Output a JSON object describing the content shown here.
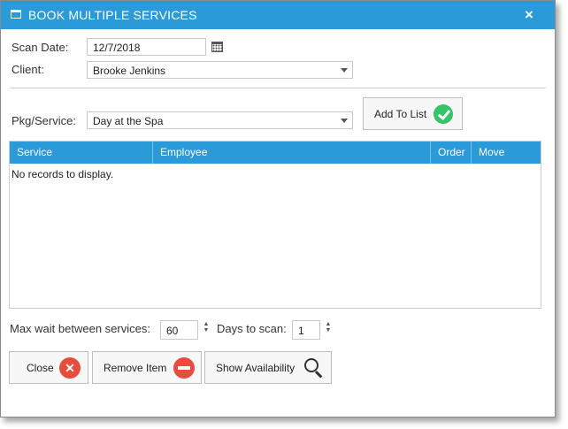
{
  "dialog": {
    "title": "BOOK MULTIPLE SERVICES",
    "close_glyph": "×"
  },
  "scan_date": {
    "label": "Scan Date:",
    "value": "12/7/2018"
  },
  "client": {
    "label": "Client:",
    "value": "Brooke Jenkins"
  },
  "service": {
    "label": "Pkg/Service:",
    "value": "Day at the Spa"
  },
  "add_button": {
    "label": "Add To List"
  },
  "table": {
    "columns": [
      "Service",
      "Employee",
      "Order",
      "Move"
    ],
    "empty_text": "No records to display."
  },
  "max_wait": {
    "label": "Max wait between services:",
    "value": "60"
  },
  "days_scan": {
    "label": "Days to scan:",
    "value": "1"
  },
  "buttons": {
    "close": "Close",
    "remove": "Remove Item",
    "availability": "Show Availability"
  },
  "colors": {
    "accent": "#2b9ad9",
    "success": "#34c46a",
    "danger": "#e84c3d"
  },
  "icons": [
    "window-icon",
    "close-icon",
    "calendar-icon",
    "dropdown-icon",
    "checkmark-icon",
    "x-circle-icon",
    "minus-circle-icon",
    "magnifier-icon"
  ]
}
